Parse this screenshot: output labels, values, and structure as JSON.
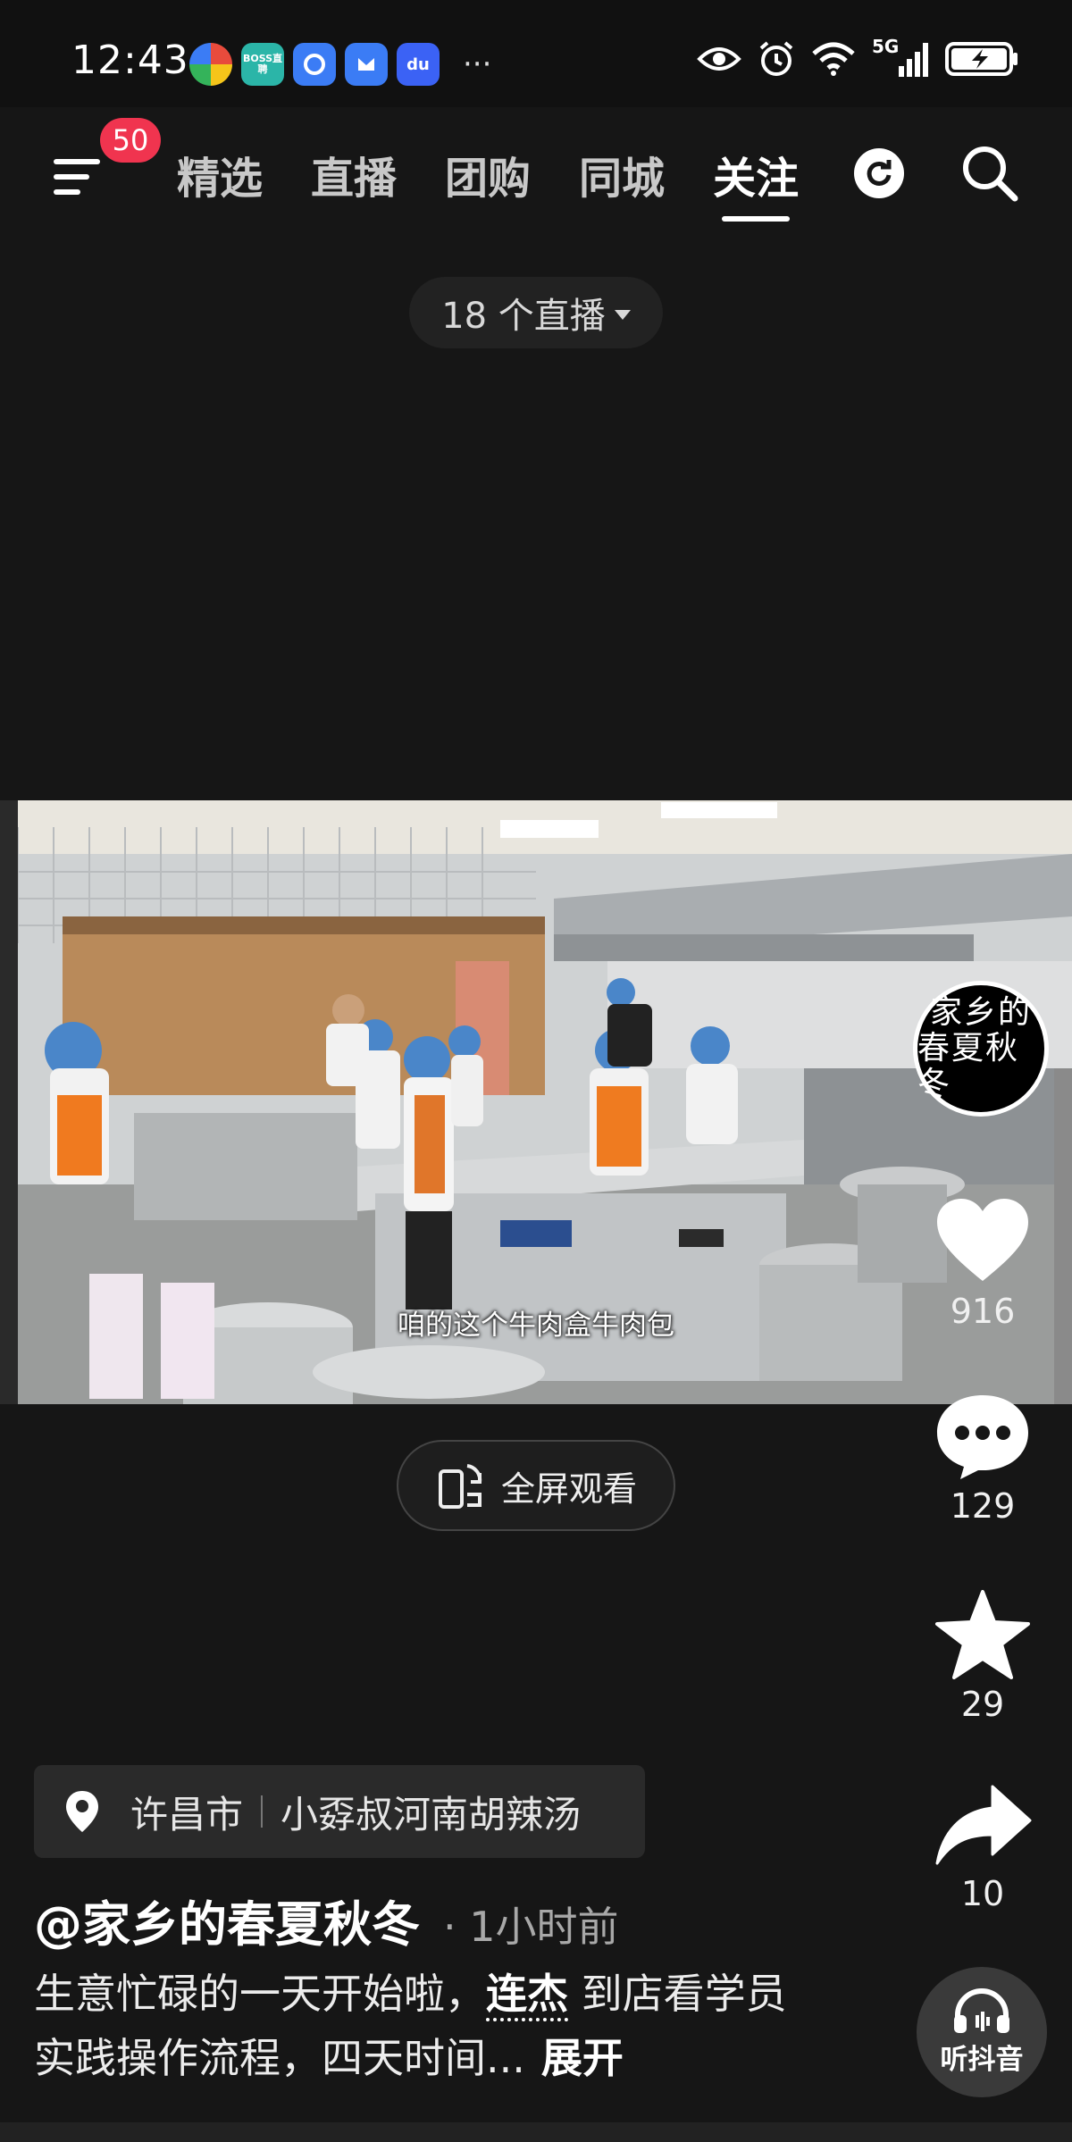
{
  "status_bar": {
    "time": "12:43",
    "app_icons": [
      {
        "name": "multicolor-app-icon",
        "label": ""
      },
      {
        "name": "boss-zhipin-icon",
        "label": "BOSS直聘",
        "color": "#2bb5a8"
      },
      {
        "name": "cloud-app-icon",
        "label": "",
        "color": "#3b7cf5"
      },
      {
        "name": "honor-app-icon",
        "label": "",
        "color": "#3b7cf5"
      },
      {
        "name": "baidu-app-icon",
        "label": "du",
        "color": "#3b62f5"
      }
    ],
    "more": "···",
    "network": "5G"
  },
  "nav": {
    "badge_count": "50",
    "tabs": [
      {
        "label": "精选",
        "active": false
      },
      {
        "label": "直播",
        "active": false
      },
      {
        "label": "团购",
        "active": false
      },
      {
        "label": "同城",
        "active": false
      },
      {
        "label": "关注",
        "active": true
      }
    ]
  },
  "live_selector": {
    "label": "18 个直播"
  },
  "video": {
    "subtitle": "咱的这个牛肉盒牛肉包"
  },
  "avatar": {
    "line1": "家乡的",
    "line2": "春夏秋冬"
  },
  "actions": {
    "likes": "916",
    "comments": "129",
    "favorites": "29",
    "shares": "10"
  },
  "fullscreen": {
    "label": "全屏观看"
  },
  "post": {
    "location_city": "许昌市",
    "location_place": "小孬叔河南胡辣汤",
    "author": "@家乡的春夏秋冬",
    "time_ago": "· 1小时前",
    "desc_part1": "生意忙碌的一天开始啦，",
    "mention": "连杰",
    "desc_part2": " 到店看学员实践操作流程，四天时间...",
    "expand": "展开"
  },
  "listen": {
    "label": "听抖音"
  },
  "colors": {
    "badge": "#f0344f",
    "background": "#161616"
  }
}
